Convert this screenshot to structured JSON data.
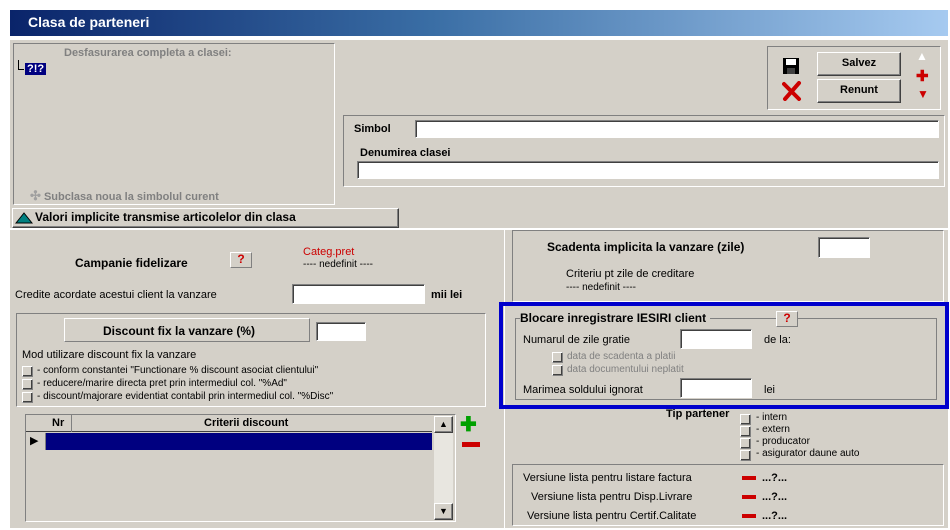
{
  "window": {
    "title": "Clasa de parteneri"
  },
  "tree": {
    "header": "Desfasurarea completa a clasei:",
    "node": "?!?",
    "add_subclass": "Subclasa noua la simbolul curent"
  },
  "actions": {
    "save": "Salvez",
    "cancel": "Renunt"
  },
  "form": {
    "simbol_label": "Simbol",
    "simbol_value": "",
    "denumire_label": "Denumirea clasei",
    "denumire_value": ""
  },
  "defaults_bar": {
    "label": "Valori implicite transmise articolelor din clasa"
  },
  "campanie": {
    "label": "Campanie fidelizare",
    "help": "?",
    "categ_label": "Categ.pret",
    "categ_value": "---- nedefinit ----"
  },
  "credite": {
    "label": "Credite acordate acestui client la vanzare",
    "value": "",
    "unit": "mii lei"
  },
  "discount": {
    "title": "Discount fix la vanzare (%)",
    "value": "",
    "mod_label": "Mod utilizare discount fix la vanzare",
    "options": [
      "- conform constantei \"Functionare % discount asociat clientului\"",
      "- reducere/marire directa pret prin intermediul col. \"%Ad\"",
      "- discount/majorare evidentiat contabil prin intermediul col. \"%Disc\""
    ]
  },
  "grid": {
    "columns": [
      "Nr",
      "Criterii discount"
    ],
    "rows": [
      {
        "nr": "",
        "criteriu": ""
      }
    ]
  },
  "scadenta": {
    "label": "Scadenta implicita la vanzare (zile)",
    "value": "",
    "criteriu_label": "Criteriu pt zile de creditare",
    "criteriu_value": "---- nedefinit ----"
  },
  "blocare": {
    "title": "Blocare inregistrare IESIRI client",
    "help": "?",
    "zile_label": "Numarul de zile gratie",
    "zile_value": "",
    "de_la": "de la:",
    "option_scadenta": "data de scadenta a platii",
    "option_document": "data documentului neplatit",
    "sold_label": "Marimea soldului ignorat",
    "sold_value": "",
    "sold_unit": "lei",
    "highlight_color": "#0000cc"
  },
  "tip_partener": {
    "label": "Tip partener",
    "options": [
      "- intern",
      "- extern",
      "- producator",
      "- asigurator daune auto"
    ]
  },
  "versiuni": [
    {
      "label": "Versiune lista pentru listare factura",
      "value": "...?..."
    },
    {
      "label": "Versiune lista pentru Disp.Livrare",
      "value": "...?..."
    },
    {
      "label": "Versiune lista pentru Certif.Calitate",
      "value": "...?..."
    }
  ]
}
